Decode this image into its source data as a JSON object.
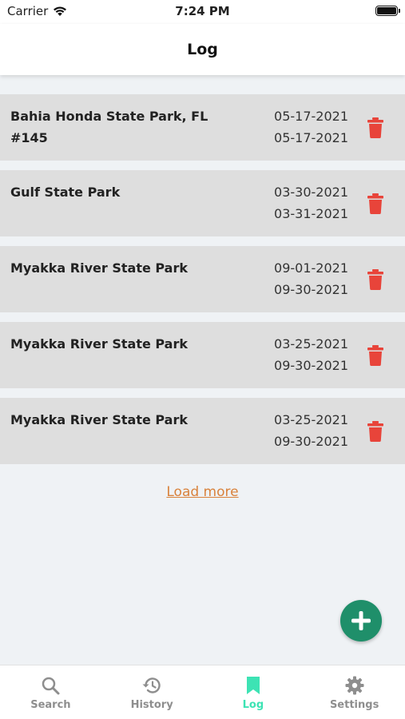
{
  "status_bar": {
    "carrier": "Carrier",
    "time": "7:24 PM"
  },
  "header": {
    "title": "Log"
  },
  "entries": [
    {
      "name": "Bahia Honda State Park, FL #145",
      "start_date": "05-17-2021",
      "end_date": "05-17-2021"
    },
    {
      "name": "Gulf State Park",
      "start_date": "03-30-2021",
      "end_date": "03-31-2021"
    },
    {
      "name": "Myakka River State Park",
      "start_date": "09-01-2021",
      "end_date": "09-30-2021"
    },
    {
      "name": "Myakka River State Park",
      "start_date": "03-25-2021",
      "end_date": "09-30-2021"
    },
    {
      "name": "Myakka River State Park",
      "start_date": "03-25-2021",
      "end_date": "09-30-2021"
    }
  ],
  "load_more_label": "Load more",
  "tabs": [
    {
      "label": "Search",
      "icon": "search-icon"
    },
    {
      "label": "History",
      "icon": "history-icon"
    },
    {
      "label": "Log",
      "icon": "bookmark-icon",
      "active": true
    },
    {
      "label": "Settings",
      "icon": "gear-icon"
    }
  ],
  "colors": {
    "delete": "#e8443a",
    "fab": "#1f8f6a",
    "active_tab": "#3de3b4",
    "link": "#d9823b",
    "card": "#dedede"
  }
}
